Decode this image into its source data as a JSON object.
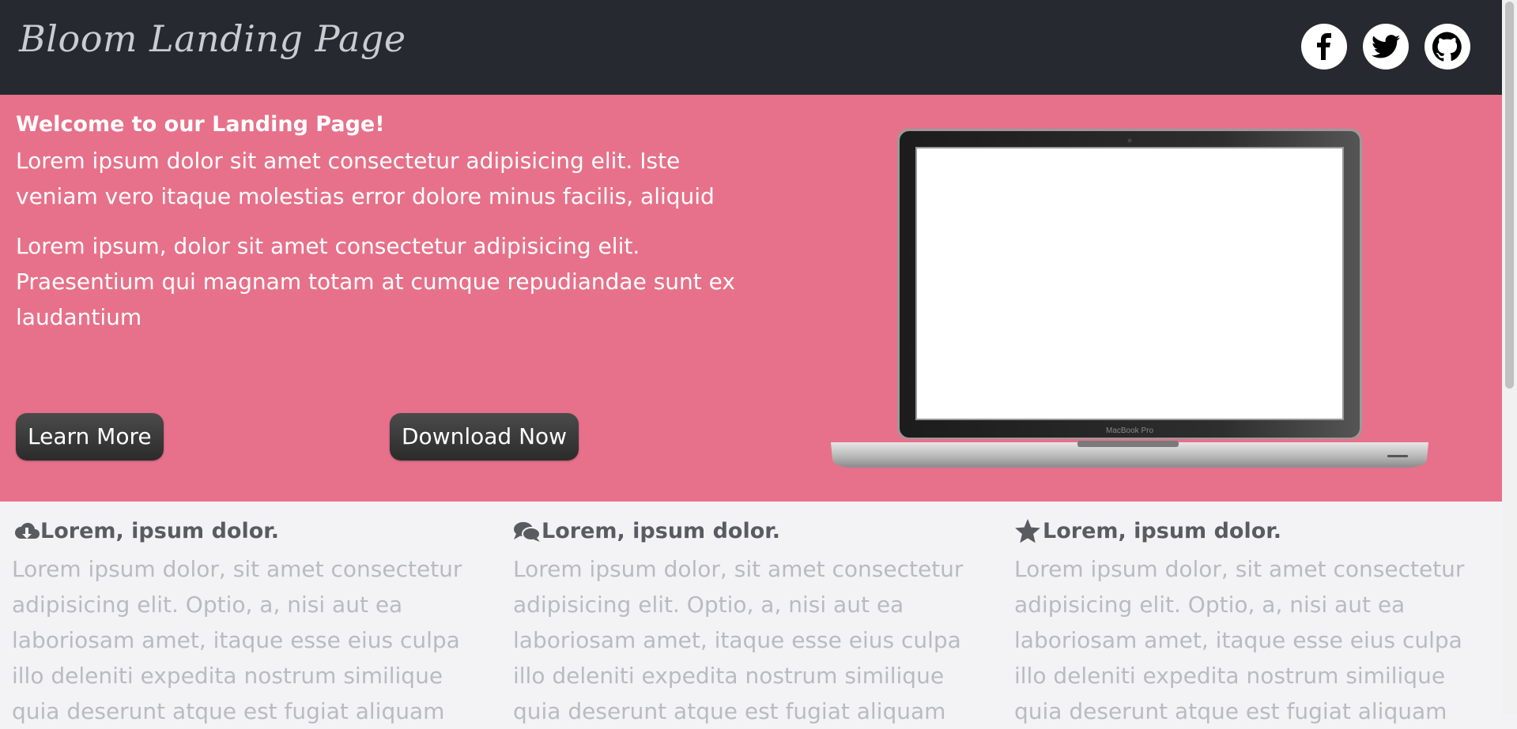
{
  "header": {
    "logo": "Bloom Landing Page",
    "social": [
      "facebook-icon",
      "twitter-icon",
      "github-icon"
    ]
  },
  "hero": {
    "title": "Welcome to our Landing Page!",
    "paragraph1": "Lorem ipsum dolor sit amet consectetur adipisicing elit. Iste veniam vero itaque molestias error dolore minus facilis, aliquid",
    "paragraph2": "Lorem ipsum, dolor sit amet consectetur adipisicing elit. Praesentium qui magnam totam at cumque repudiandae sunt ex laudantium",
    "learn_more": "Learn More",
    "download_now": "Download Now",
    "laptop_brand": "MacBook Pro"
  },
  "features": [
    {
      "icon": "cloud-download-icon",
      "title": "Lorem, ipsum dolor.",
      "text": "Lorem ipsum dolor, sit amet consectetur adipisicing elit. Optio, a, nisi aut ea laboriosam amet, itaque esse eius culpa illo deleniti expedita nostrum similique quia deserunt atque est fugiat aliquam"
    },
    {
      "icon": "comments-icon",
      "title": "Lorem, ipsum dolor.",
      "text": "Lorem ipsum dolor, sit amet consectetur adipisicing elit. Optio, a, nisi aut ea laboriosam amet, itaque esse eius culpa illo deleniti expedita nostrum similique quia deserunt atque est fugiat aliquam"
    },
    {
      "icon": "star-icon",
      "title": "Lorem, ipsum dolor.",
      "text": "Lorem ipsum dolor, sit amet consectetur adipisicing elit. Optio, a, nisi aut ea laboriosam amet, itaque esse eius culpa illo deleniti expedita nostrum similique quia deserunt atque est fugiat aliquam"
    }
  ],
  "colors": {
    "header_bg": "#262a30",
    "hero_bg": "#e7718a",
    "features_bg": "#f3f3f5",
    "button_bg": "#3a3a3a"
  }
}
